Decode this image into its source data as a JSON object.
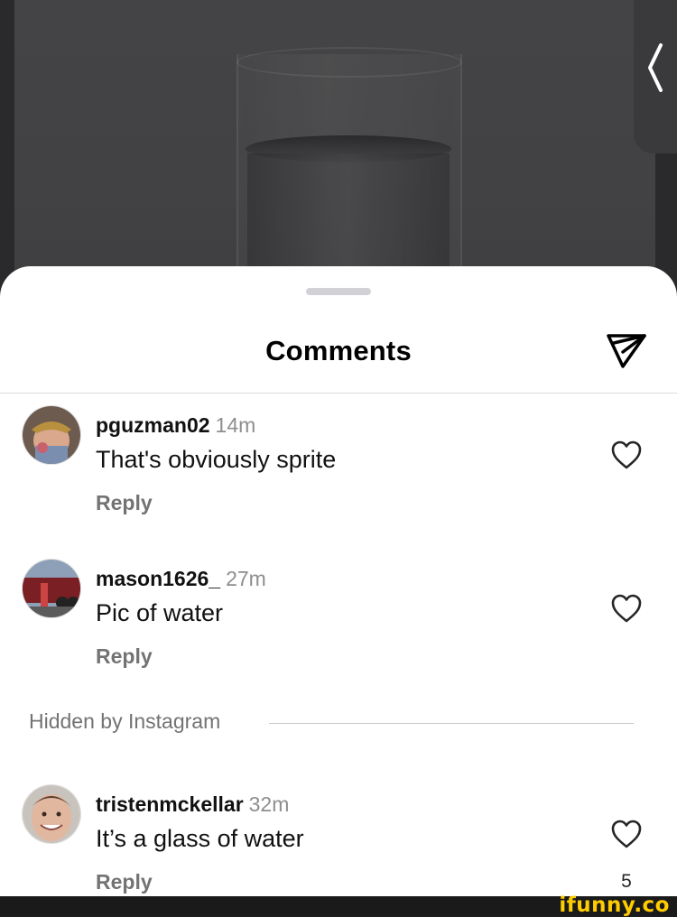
{
  "sheet": {
    "title": "Comments"
  },
  "comments": [
    {
      "username": "pguzman02",
      "time": "14m",
      "text": "That's obviously sprite",
      "reply_label": "Reply",
      "like_count": ""
    },
    {
      "username": "mason1626_",
      "time": "27m",
      "text": "Pic of water",
      "reply_label": "Reply",
      "like_count": ""
    },
    {
      "username": "tristenmckellar",
      "time": "32m",
      "text": "It’s a glass of water",
      "reply_label": "Reply",
      "like_count": "5"
    }
  ],
  "hidden_section": {
    "label": "Hidden by Instagram"
  },
  "watermark": {
    "text": "ifunny.co"
  },
  "icons": {
    "send": "send-icon",
    "heart": "heart-icon",
    "back": "chevron-left-icon"
  },
  "colors": {
    "sheet_bg": "#ffffff",
    "muted_text": "#737373",
    "watermark": "#ffcc00"
  }
}
